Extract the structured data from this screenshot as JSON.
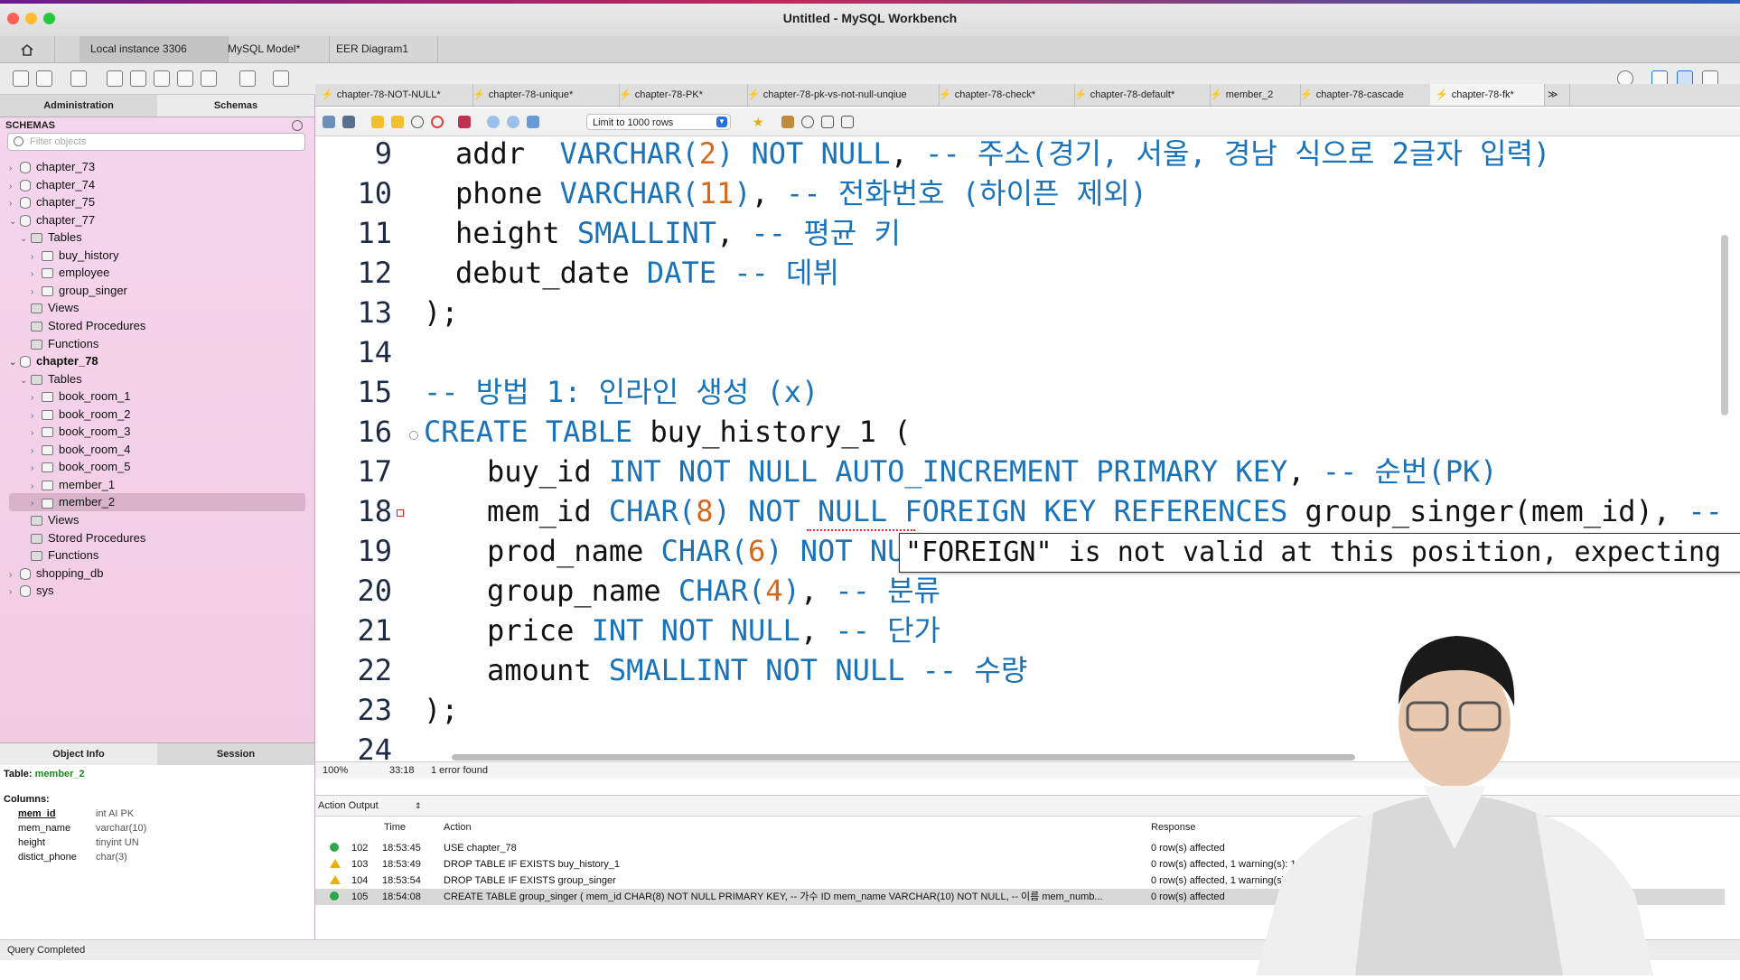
{
  "window": {
    "title": "Untitled - MySQL Workbench"
  },
  "connection_tabs": [
    "Local instance 3306",
    "MySQL Model*",
    "EER Diagram1"
  ],
  "side_tabs": {
    "administration": "Administration",
    "schemas": "Schemas"
  },
  "schemas": {
    "header": "SCHEMAS",
    "filter_placeholder": "Filter objects",
    "tree": [
      {
        "label": "chapter_73",
        "level": 0,
        "type": "db",
        "expanded": false
      },
      {
        "label": "chapter_74",
        "level": 0,
        "type": "db",
        "expanded": false
      },
      {
        "label": "chapter_75",
        "level": 0,
        "type": "db",
        "expanded": false
      },
      {
        "label": "chapter_77",
        "level": 0,
        "type": "db",
        "expanded": true
      },
      {
        "label": "Tables",
        "level": 1,
        "type": "folder",
        "expanded": true
      },
      {
        "label": "buy_history",
        "level": 2,
        "type": "table",
        "expanded": false
      },
      {
        "label": "employee",
        "level": 2,
        "type": "table",
        "expanded": false
      },
      {
        "label": "group_singer",
        "level": 2,
        "type": "table",
        "expanded": false
      },
      {
        "label": "Views",
        "level": 1,
        "type": "folder"
      },
      {
        "label": "Stored Procedures",
        "level": 1,
        "type": "folder"
      },
      {
        "label": "Functions",
        "level": 1,
        "type": "folder"
      },
      {
        "label": "chapter_78",
        "level": 0,
        "type": "db",
        "expanded": true,
        "bold": true
      },
      {
        "label": "Tables",
        "level": 1,
        "type": "folder",
        "expanded": true
      },
      {
        "label": "book_room_1",
        "level": 2,
        "type": "table",
        "expanded": false
      },
      {
        "label": "book_room_2",
        "level": 2,
        "type": "table",
        "expanded": false
      },
      {
        "label": "book_room_3",
        "level": 2,
        "type": "table",
        "expanded": false
      },
      {
        "label": "book_room_4",
        "level": 2,
        "type": "table",
        "expanded": false
      },
      {
        "label": "book_room_5",
        "level": 2,
        "type": "table",
        "expanded": false
      },
      {
        "label": "member_1",
        "level": 2,
        "type": "table",
        "expanded": false
      },
      {
        "label": "member_2",
        "level": 2,
        "type": "table",
        "expanded": false,
        "selected": true
      },
      {
        "label": "Views",
        "level": 1,
        "type": "folder"
      },
      {
        "label": "Stored Procedures",
        "level": 1,
        "type": "folder"
      },
      {
        "label": "Functions",
        "level": 1,
        "type": "folder"
      },
      {
        "label": "shopping_db",
        "level": 0,
        "type": "db",
        "expanded": false
      },
      {
        "label": "sys",
        "level": 0,
        "type": "db",
        "expanded": false
      }
    ]
  },
  "info_tabs": {
    "object_info": "Object Info",
    "session": "Session"
  },
  "object_info": {
    "table_label": "Table:",
    "table_name": "member_2",
    "columns_label": "Columns:",
    "columns": [
      {
        "name": "mem_id",
        "type": "int AI PK"
      },
      {
        "name": "mem_name",
        "type": "varchar(10)"
      },
      {
        "name": "height",
        "type": "tinyint UN"
      },
      {
        "name": "distict_phone",
        "type": "char(3)"
      }
    ]
  },
  "status_bar": "Query Completed",
  "editor_tabs": [
    "chapter-78-NOT-NULL*",
    "chapter-78-unique*",
    "chapter-78-PK*",
    "chapter-78-pk-vs-not-null-unqiue",
    "chapter-78-check*",
    "chapter-78-default*",
    "member_2",
    "chapter-78-cascade",
    "chapter-78-fk*"
  ],
  "sql_toolbar": {
    "limit": "Limit to 1000 rows"
  },
  "code_lines": [
    {
      "n": "9",
      "tokens": [
        [
          "",
          "addr  "
        ],
        [
          "kw",
          "VARCHAR("
        ],
        [
          "num",
          "2"
        ],
        [
          "kw",
          ") NOT NULL"
        ],
        [
          "",
          ", "
        ],
        [
          "cm",
          "-- 주소(경기, 서울, 경남 식으로 2글자 입력)"
        ]
      ],
      "indent": 1
    },
    {
      "n": "10",
      "tokens": [
        [
          "",
          "phone "
        ],
        [
          "kw",
          "VARCHAR("
        ],
        [
          "num",
          "11"
        ],
        [
          "kw",
          ")"
        ],
        [
          "",
          ", "
        ],
        [
          "cm",
          "-- 전화번호 (하이픈 제외)"
        ]
      ],
      "indent": 1
    },
    {
      "n": "11",
      "tokens": [
        [
          "",
          "height "
        ],
        [
          "kw",
          "SMALLINT"
        ],
        [
          "",
          ", "
        ],
        [
          "cm",
          "-- 평균 키"
        ]
      ],
      "indent": 1
    },
    {
      "n": "12",
      "tokens": [
        [
          "",
          "debut_date "
        ],
        [
          "kw",
          "DATE"
        ],
        [
          "",
          " "
        ],
        [
          "cm",
          "-- 데뷔"
        ]
      ],
      "indent": 1
    },
    {
      "n": "13",
      "tokens": [
        [
          "",
          ");"
        ]
      ],
      "indent": 0
    },
    {
      "n": "14",
      "tokens": [],
      "indent": 0
    },
    {
      "n": "15",
      "tokens": [
        [
          "cm",
          "-- 방법 1: 인라인 생성 (x)"
        ]
      ],
      "indent": 0
    },
    {
      "n": "16",
      "tokens": [
        [
          "kw",
          "CREATE TABLE"
        ],
        [
          "",
          " buy_history_1 ("
        ]
      ],
      "indent": 0
    },
    {
      "n": "17",
      "tokens": [
        [
          "",
          "buy_id "
        ],
        [
          "kw",
          "INT NOT NULL AUTO_INCREMENT PRIMARY KEY"
        ],
        [
          "",
          ", "
        ],
        [
          "cm",
          "-- 순번(PK)"
        ]
      ],
      "indent": 2
    },
    {
      "n": "18",
      "tokens": [
        [
          "",
          "mem_id "
        ],
        [
          "kw",
          "CHAR("
        ],
        [
          "num",
          "8"
        ],
        [
          "kw",
          ") NOT NULL FOREIGN KEY REFERENCES"
        ],
        [
          "",
          " group_singer(mem_id), "
        ],
        [
          "cm",
          "-- 아이디"
        ]
      ],
      "indent": 2
    },
    {
      "n": "19",
      "tokens": [
        [
          "",
          "prod_name "
        ],
        [
          "kw",
          "CHAR("
        ],
        [
          "num",
          "6"
        ],
        [
          "kw",
          ") NOT NULL"
        ]
      ],
      "indent": 2
    },
    {
      "n": "20",
      "tokens": [
        [
          "",
          "group_name "
        ],
        [
          "kw",
          "CHAR("
        ],
        [
          "num",
          "4"
        ],
        [
          "kw",
          ")"
        ],
        [
          "",
          ", "
        ],
        [
          "cm",
          "-- 분류"
        ]
      ],
      "indent": 2
    },
    {
      "n": "21",
      "tokens": [
        [
          "",
          "price "
        ],
        [
          "kw",
          "INT NOT NULL"
        ],
        [
          "",
          ", "
        ],
        [
          "cm",
          "-- 단가"
        ]
      ],
      "indent": 2
    },
    {
      "n": "22",
      "tokens": [
        [
          "",
          "amount "
        ],
        [
          "kw",
          "SMALLINT NOT NULL"
        ],
        [
          "",
          " "
        ],
        [
          "cm",
          "-- 수량"
        ]
      ],
      "indent": 2
    },
    {
      "n": "23",
      "tokens": [
        [
          "",
          ");"
        ]
      ],
      "indent": 0
    },
    {
      "n": "24",
      "tokens": [],
      "indent": 0
    }
  ],
  "error_tooltip": "\"FOREIGN\" is not valid at this position, expecting ')",
  "editor_status": {
    "zoom": "100%",
    "position": "33:18",
    "errors": "1 error found"
  },
  "output": {
    "selector": "Action Output",
    "columns": {
      "time": "Time",
      "action": "Action",
      "response": "Response"
    },
    "rows": [
      {
        "status": "ok",
        "n": "102",
        "time": "18:53:45",
        "action": "USE chapter_78",
        "response": "0 row(s) affected"
      },
      {
        "status": "warn",
        "n": "103",
        "time": "18:53:49",
        "action": "DROP TABLE IF EXISTS buy_history_1",
        "response": "0 row(s) affected, 1 warning(s): 10"
      },
      {
        "status": "warn",
        "n": "104",
        "time": "18:53:54",
        "action": "DROP TABLE IF EXISTS group_singer",
        "response": "0 row(s) affected, 1 warning(s): 1"
      },
      {
        "status": "ok",
        "n": "105",
        "time": "18:54:08",
        "action": "CREATE TABLE group_singer (   mem_id CHAR(8) NOT NULL PRIMARY KEY, -- 가수 ID   mem_name VARCHAR(10) NOT NULL, -- 이름   mem_numb...",
        "response": "0 row(s) affected",
        "selected": true
      }
    ]
  },
  "colors": {
    "keyword": "#1a73b8",
    "number": "#d2691e",
    "sidebar": "#f3cfe8",
    "error": "#dd2222"
  }
}
